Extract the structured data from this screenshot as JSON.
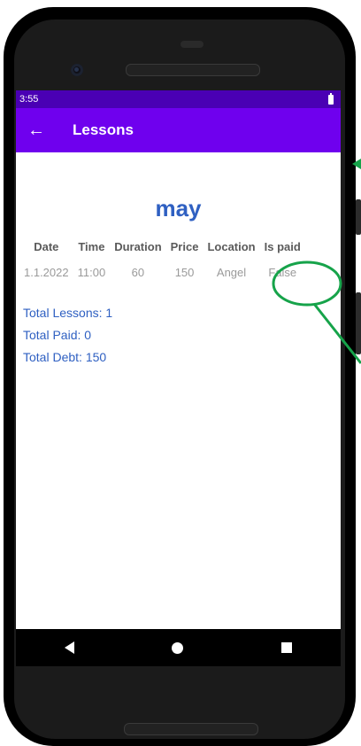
{
  "status_bar": {
    "time": "3:55"
  },
  "app_bar": {
    "title": "Lessons"
  },
  "month": "may",
  "table": {
    "headers": [
      "Date",
      "Time",
      "Duration",
      "Price",
      "Location",
      "Is paid"
    ],
    "rows": [
      [
        "1.1.2022",
        "11:00",
        "60",
        "150",
        "Angel",
        "False"
      ]
    ]
  },
  "totals": {
    "lessons": "Total Lessons: 1",
    "paid": "Total Paid: 0",
    "debt": "Total Debt: 150"
  },
  "colors": {
    "status_bar": "#4a00b4",
    "app_bar": "#6f00ee",
    "accent_text": "#2f60c2",
    "annotation": "#16a34a"
  }
}
